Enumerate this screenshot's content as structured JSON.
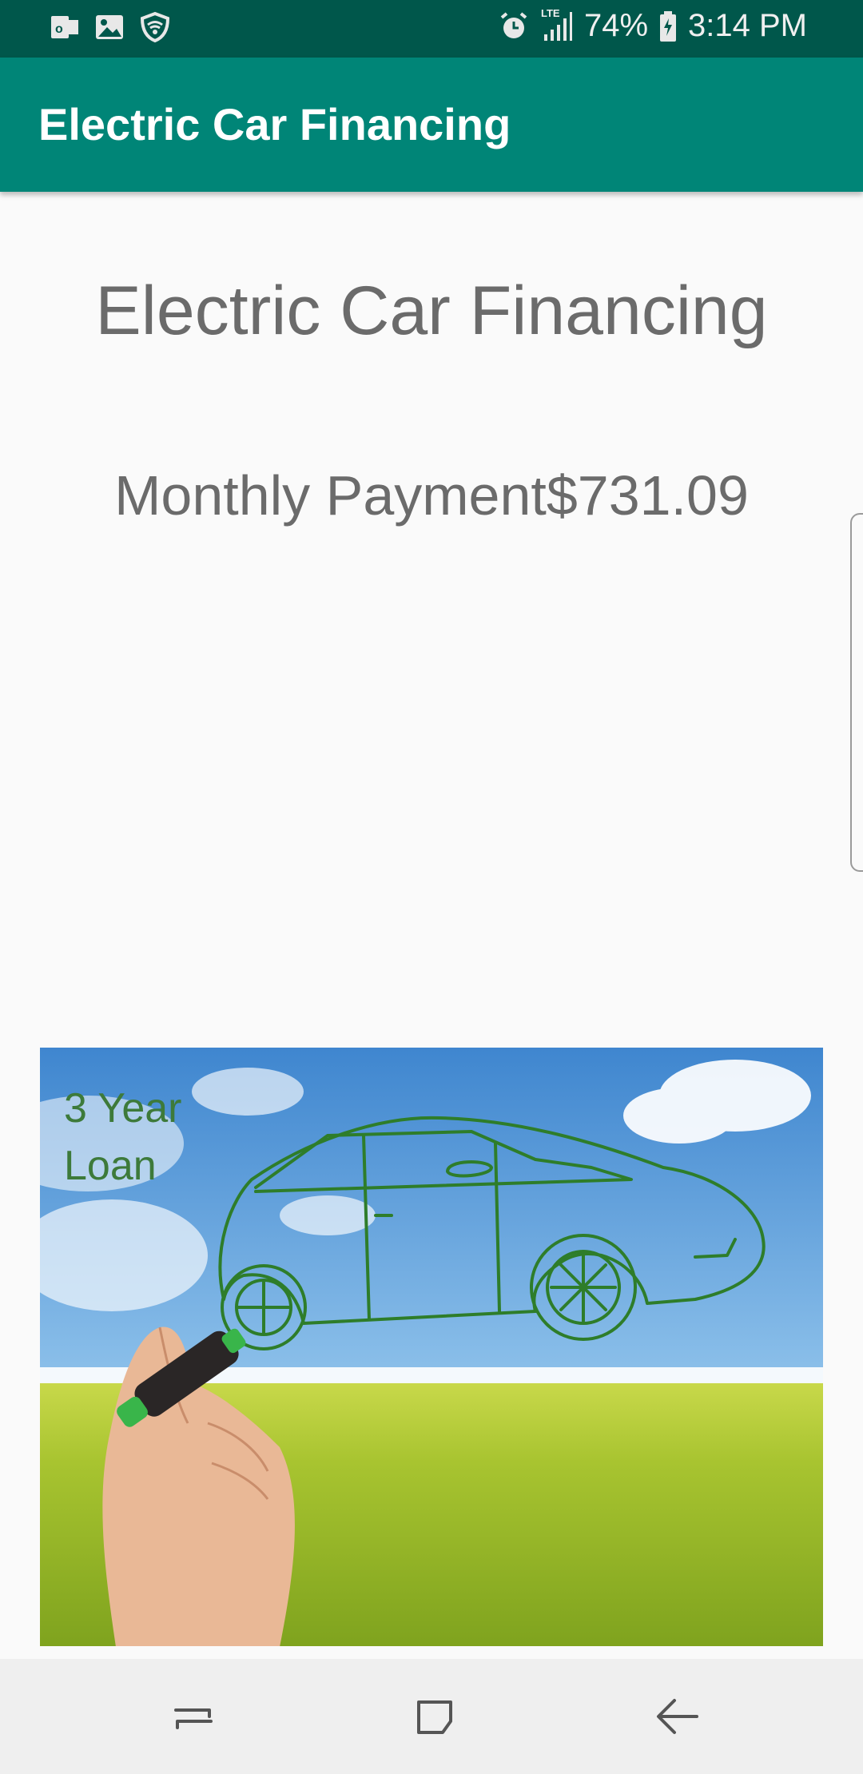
{
  "status_bar": {
    "battery": "74%",
    "time": "3:14 PM",
    "network": "LTE",
    "left_icons": [
      "outlook-icon",
      "gallery-icon",
      "shield-wifi-icon"
    ],
    "right_icons": [
      "alarm-icon",
      "signal-icon",
      "battery-icon"
    ]
  },
  "app_bar": {
    "title": "Electric Car Financing"
  },
  "main": {
    "heading": "Electric Car Financing",
    "payment_label": "Monthly Payment",
    "payment_value": "$731.09"
  },
  "hero": {
    "caption_line1": "3 Year",
    "caption_line2": "Loan"
  },
  "nav_bar": {
    "buttons": [
      "recents-icon",
      "home-icon",
      "back-icon"
    ]
  },
  "colors": {
    "primary": "#008577",
    "primary_dark": "#00574b",
    "text": "#6b6b6b",
    "caption": "#3d7a3a"
  }
}
